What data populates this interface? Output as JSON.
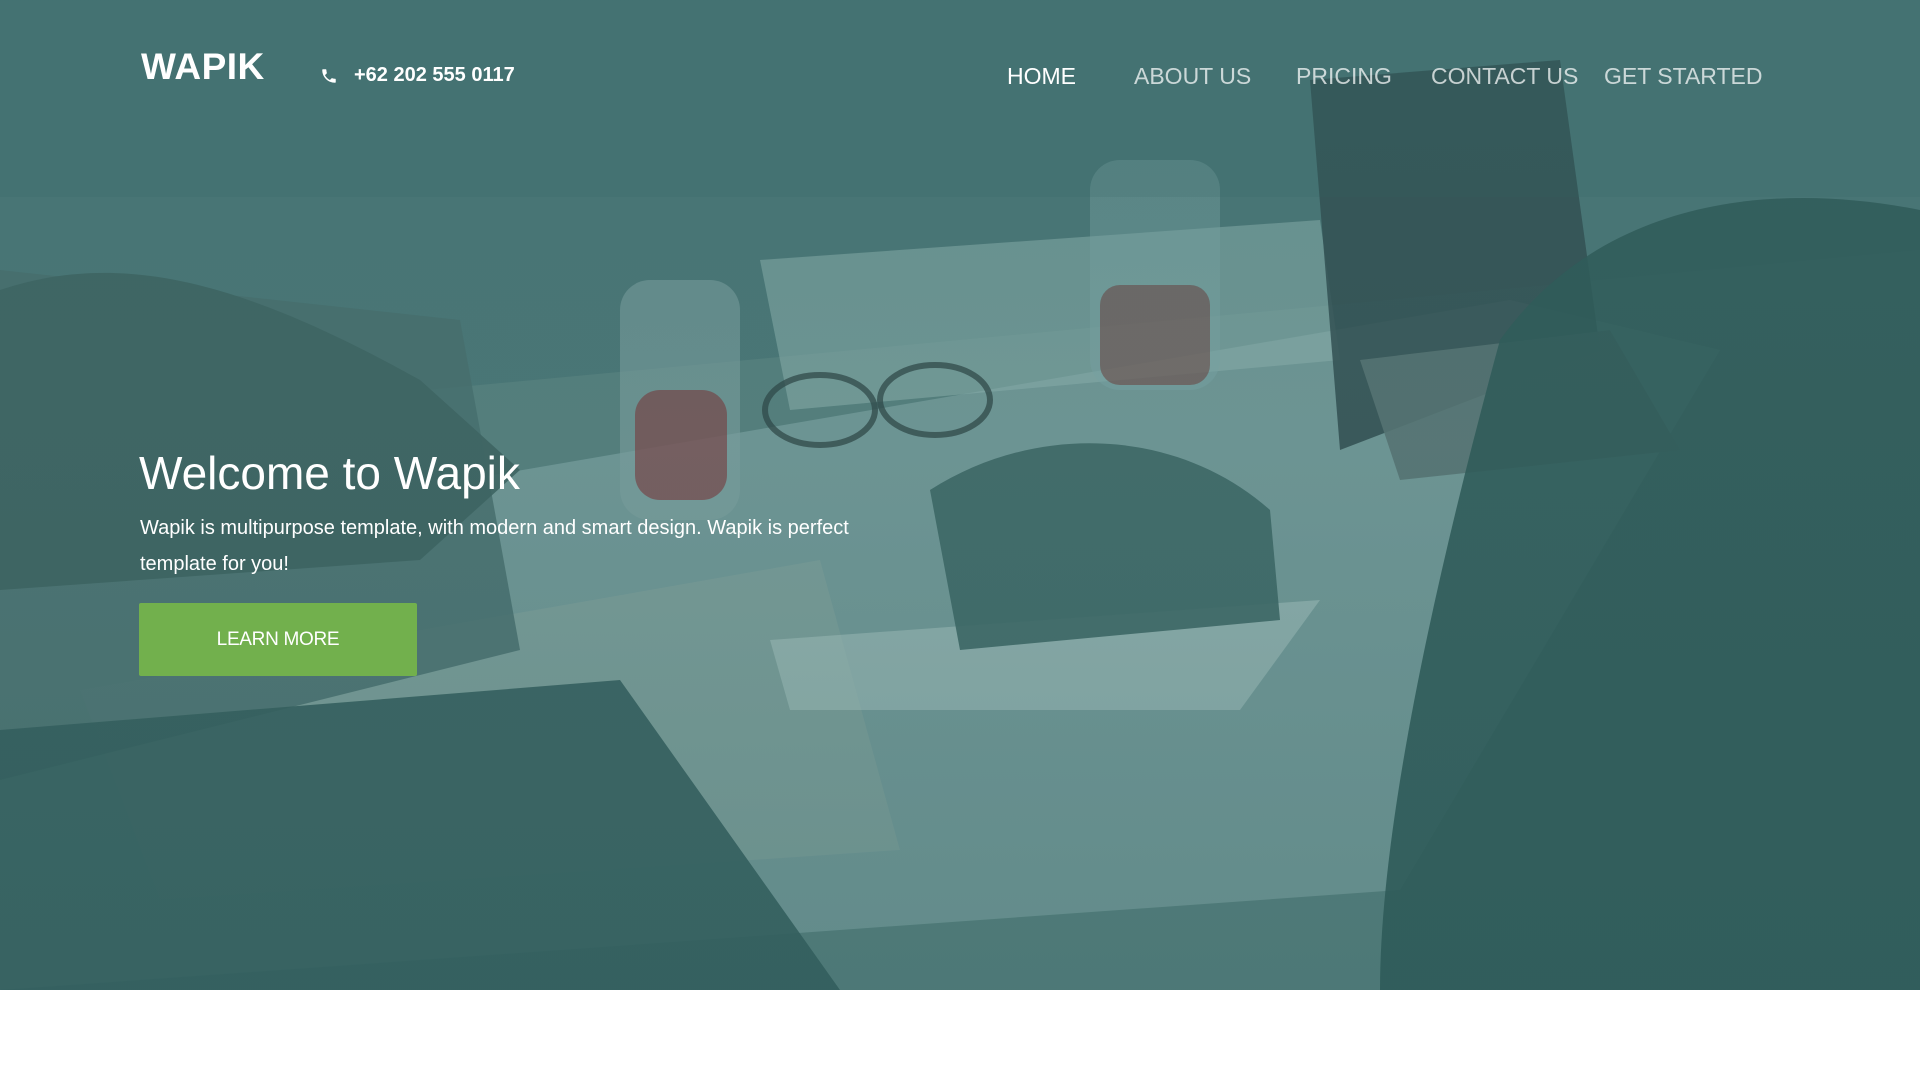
{
  "header": {
    "logo": "WAPIK",
    "phone": "+62 202 555 0117",
    "phone_icon": "phone-icon"
  },
  "nav": {
    "items": [
      {
        "label": "HOME",
        "active": true
      },
      {
        "label": "ABOUT US",
        "active": false
      },
      {
        "label": "PRICING",
        "active": false
      },
      {
        "label": "CONTACT US",
        "active": false
      },
      {
        "label": "GET STARTED",
        "active": false
      }
    ]
  },
  "hero": {
    "title": "Welcome to Wapik",
    "subtitle": "Wapik is multipurpose template, with modern and smart design. Wapik is perfect template for you!",
    "cta_label": "LEARN MORE",
    "background_image": "people-working-at-table-photo"
  },
  "colors": {
    "overlay": "#3f6b6b",
    "cta": "#72b04d",
    "text": "#ffffff"
  }
}
